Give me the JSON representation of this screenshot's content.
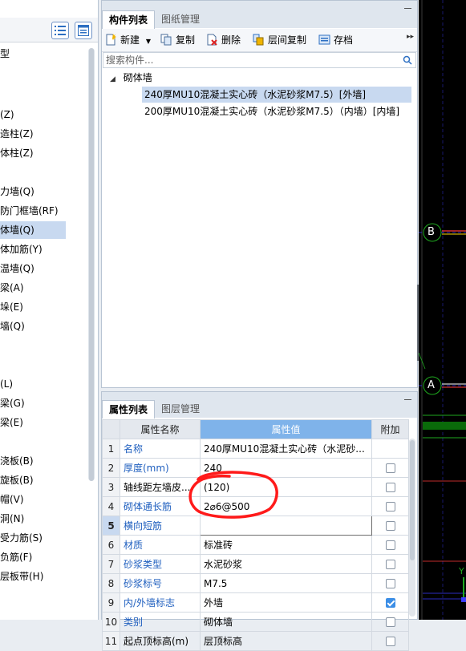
{
  "left_panel": {
    "items": [
      "型",
      "(Z)",
      "造柱(Z)",
      "体柱(Z)",
      "力墙(Q)",
      "防门框墙(RF)",
      "体墙(Q)",
      "体加筋(Y)",
      "温墙(Q)",
      "梁(A)",
      "垛(E)",
      "墙(Q)",
      "(L)",
      "梁(G)",
      "梁(E)",
      "浇板(B)",
      "旋板(B)",
      "帽(V)",
      "洞(N)",
      "受力筋(S)",
      "负筋(F)",
      "层板带(H)"
    ],
    "selected_index": 6
  },
  "component_panel": {
    "tabs": [
      "构件列表",
      "图纸管理"
    ],
    "toolbar": {
      "new_label": "新建",
      "copy_label": "复制",
      "delete_label": "删除",
      "floor_copy_label": "层间复制",
      "archive_label": "存档"
    },
    "search_placeholder": "搜索构件...",
    "tree": {
      "group": "砌体墙",
      "items": [
        "240厚MU10混凝土实心砖（水泥砂浆M7.5）[外墙]",
        "200厚MU10混凝土实心砖（水泥砂浆M7.5）（内墙）[内墙]"
      ],
      "selected_index": 0
    }
  },
  "property_panel": {
    "tabs": [
      "属性列表",
      "图层管理"
    ],
    "headers": [
      "属性名称",
      "属性值",
      "附加"
    ],
    "rows": [
      {
        "num": "1",
        "name": "名称",
        "value": "240厚MU10混凝土实心砖（水泥砂...",
        "checkbox": null,
        "blue": true
      },
      {
        "num": "2",
        "name": "厚度(mm)",
        "value": "240",
        "checkbox": false,
        "blue": true
      },
      {
        "num": "3",
        "name": "轴线距左墙皮...",
        "value": "(120)",
        "checkbox": false,
        "blue": false
      },
      {
        "num": "4",
        "name": "砌体通长筋",
        "value": "2⌀6@500",
        "checkbox": false,
        "blue": true
      },
      {
        "num": "5",
        "name": "横向短筋",
        "value": "",
        "checkbox": false,
        "blue": true
      },
      {
        "num": "6",
        "name": "材质",
        "value": "标准砖",
        "checkbox": false,
        "blue": true
      },
      {
        "num": "7",
        "name": "砂浆类型",
        "value": "水泥砂浆",
        "checkbox": false,
        "blue": true
      },
      {
        "num": "8",
        "name": "砂浆标号",
        "value": "M7.5",
        "checkbox": false,
        "blue": true
      },
      {
        "num": "9",
        "name": "内/外墙标志",
        "value": "外墙",
        "checkbox": true,
        "blue": true
      },
      {
        "num": "10",
        "name": "类别",
        "value": "砌体墙",
        "checkbox": false,
        "blue": true
      },
      {
        "num": "11",
        "name": "起点顶标高(m)",
        "value": "层顶标高",
        "checkbox": false,
        "blue": false
      }
    ],
    "current_row": 4
  },
  "cad_canvas": {
    "axis_labels": [
      "B",
      "A",
      "Y"
    ],
    "background": "#000000",
    "line_colors": [
      "#ff3b3b",
      "#1fa81f",
      "#2f5bff",
      "#ffd700",
      "#ffffff"
    ]
  },
  "annotation": {
    "color": "#ff1a1a"
  }
}
